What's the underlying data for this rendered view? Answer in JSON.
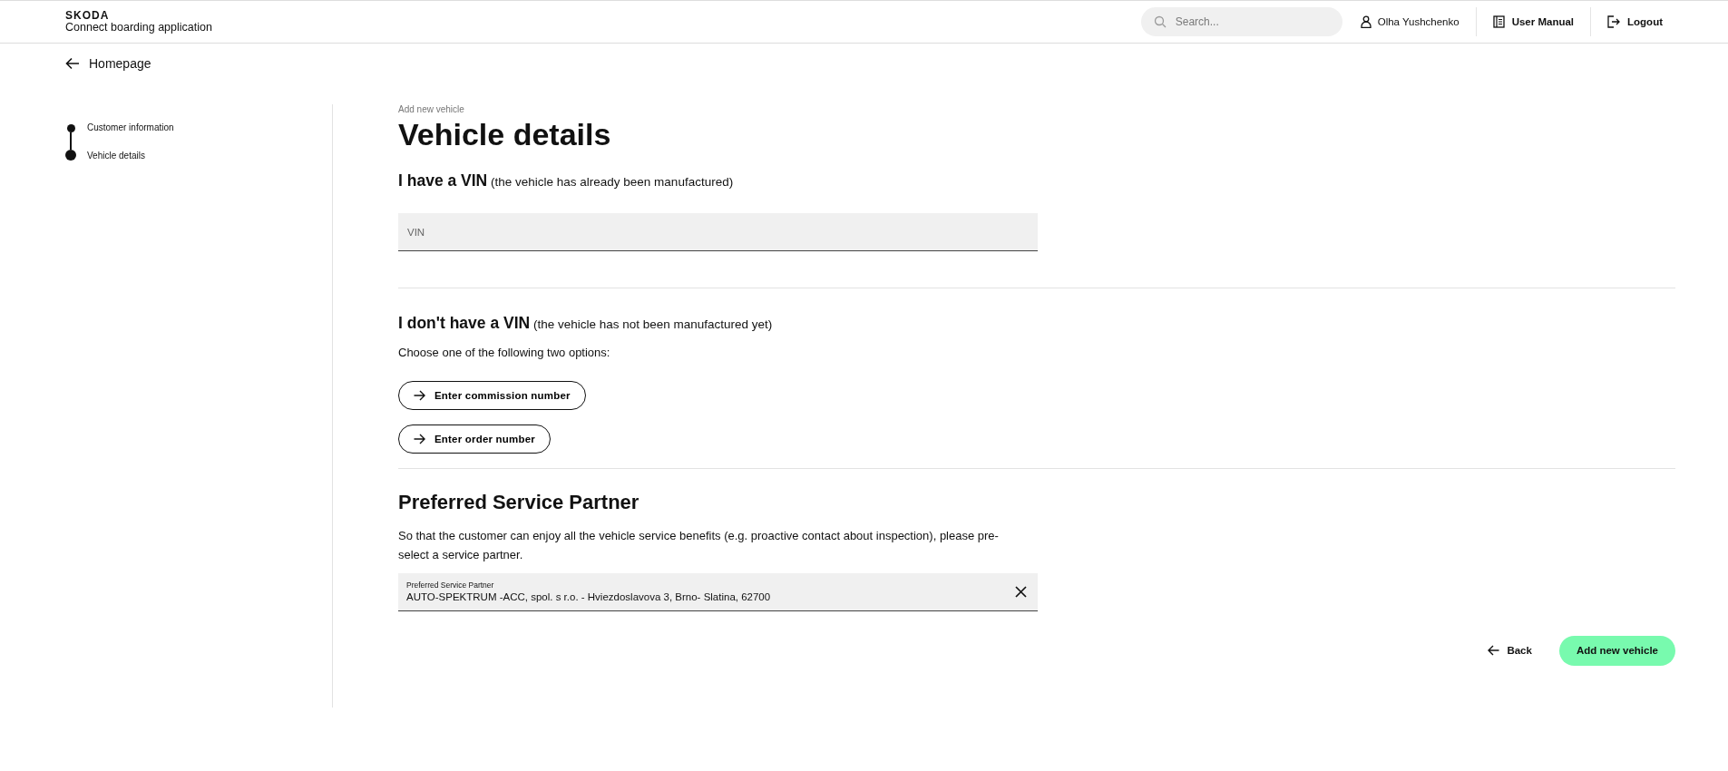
{
  "header": {
    "brand": "SKODA",
    "app_name": "Connect boarding application",
    "search": {
      "placeholder": "Search..."
    },
    "user": "Olha Yushchenko",
    "links": [
      {
        "label": "User Manual",
        "kind": "manual"
      },
      {
        "label": "Logout",
        "kind": "logout"
      }
    ]
  },
  "back_link": "Homepage",
  "steps": [
    {
      "label": "Customer information",
      "selected": false
    },
    {
      "label": "Vehicle details",
      "selected": true
    }
  ],
  "breadcrumb": "Add new vehicle",
  "title": "Vehicle details",
  "vin_section": {
    "heading": "**I have a VIN** (the vehicle has already been manufactured)",
    "field": {
      "placeholder": "VIN"
    }
  },
  "no_vin_section": {
    "heading": "**I don't have a VIN** (the vehicle has not been manufactured yet)",
    "text": "Choose one of the following two options:",
    "buttons": [
      "Enter commission number",
      "Enter order number"
    ]
  },
  "service_partner": {
    "heading": "Preferred Service Partner",
    "text": "So that the customer can enjoy all the vehicle service benefits (e.g. proactive contact about inspection), please pre-select a service partner.",
    "field": {
      "label": "Preferred Service Partner",
      "value": "AUTO-SPEKTRUM -ACC, spol. s r.o. - Hviezdoslavova 3, Brno- Slatina, 62700"
    }
  },
  "actions": {
    "back": "Back",
    "submit": "Add new vehicle"
  }
}
